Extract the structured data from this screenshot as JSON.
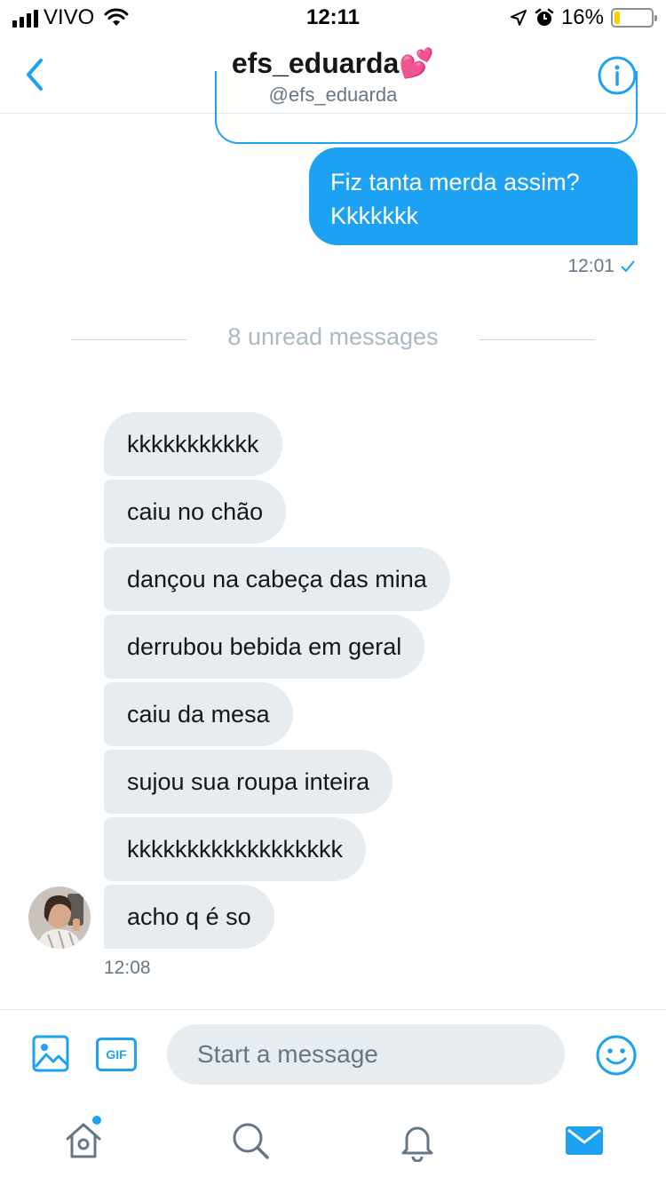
{
  "status_bar": {
    "carrier": "VIVO",
    "time": "12:11",
    "battery_percent": "16%",
    "battery_level": 0.16,
    "icons": [
      "signal-icon",
      "wifi-icon",
      "location-icon",
      "alarm-icon",
      "battery-icon"
    ]
  },
  "header": {
    "title": "efs_eduarda💕",
    "handle": "@efs_eduarda",
    "back_icon": "chevron-left-icon",
    "info_icon": "info-icon"
  },
  "conversation": {
    "sent": {
      "text": "Fiz tanta merda assim? Kkkkkkk",
      "time": "12:01",
      "status_icon": "checkmark-icon"
    },
    "unread_divider": "8 unread messages",
    "received": [
      "kkkkkkkkkkk",
      "caiu no chão",
      "dançou na cabeça das mina",
      "derrubou bebida em geral",
      "caiu da mesa",
      "sujou sua roupa inteira",
      "kkkkkkkkkkkkkkkkkk",
      "acho q é so"
    ],
    "received_time": "12:08"
  },
  "composer": {
    "placeholder": "Start a message",
    "gif_label": "GIF",
    "icons": [
      "image-icon",
      "gif-icon",
      "emoji-icon"
    ]
  },
  "tab_bar": {
    "tabs": [
      "home-icon",
      "search-icon",
      "notifications-icon",
      "messages-icon"
    ],
    "active": "messages-icon",
    "accent": "#1da1f2"
  },
  "colors": {
    "accent": "#1da1f2",
    "received_bubble": "#e6ecf0",
    "secondary_text": "#657786"
  }
}
